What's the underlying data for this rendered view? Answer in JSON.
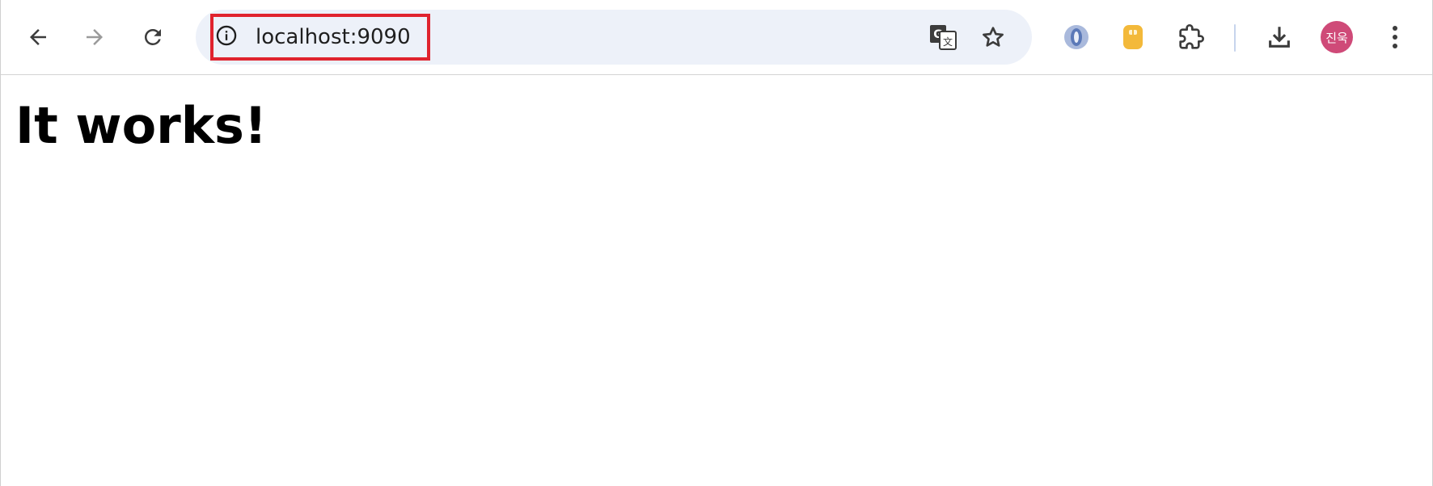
{
  "browser": {
    "address_bar": {
      "url": "localhost:9090"
    },
    "profile": {
      "avatar_text": "진욱",
      "avatar_color": "#cf4a78"
    },
    "icons": {
      "back": "arrow-left-icon",
      "forward": "arrow-right-icon",
      "reload": "reload-icon",
      "site_info": "info-icon",
      "translate": "translate-icon",
      "bookmark": "star-icon",
      "extension_1": "json-viewer-extension-icon",
      "extension_2": "yellow-extension-icon",
      "extensions": "puzzle-icon",
      "downloads": "download-icon",
      "menu": "kebab-menu-icon"
    },
    "highlight_color": "#e0232e"
  },
  "page": {
    "heading": "It works!"
  }
}
